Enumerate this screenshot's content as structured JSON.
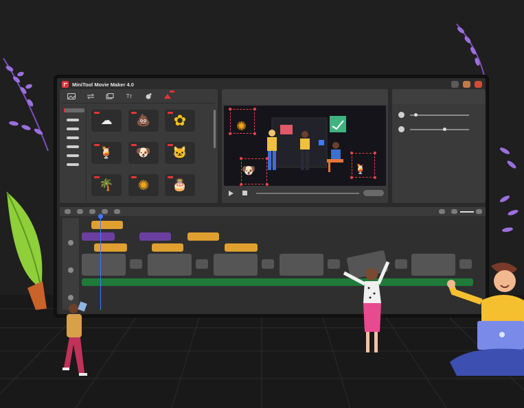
{
  "app": {
    "title": "MiniTool Movie Maker 4.0"
  },
  "colors": {
    "background": "#1f1f1f",
    "panel": "#3a3a3a",
    "accent_red": "#e33333",
    "clip_orange": "#e0a030",
    "clip_purple": "#6a3fa0",
    "clip_gray": "#555555",
    "audio_green": "#1f7a3a",
    "playhead_blue": "#3d7bff"
  },
  "media_toolbar": {
    "icons": [
      "media-icon",
      "transition-icon",
      "effects-icon",
      "text-icon",
      "filter-icon",
      "sticker-icon"
    ],
    "text_tab_label": "Tт"
  },
  "stickers": [
    {
      "name": "cloud",
      "glyph": "☁"
    },
    {
      "name": "poop",
      "glyph": "💩"
    },
    {
      "name": "flower",
      "glyph": "✿"
    },
    {
      "name": "drink",
      "glyph": "🍹"
    },
    {
      "name": "shiba",
      "glyph": "🐶"
    },
    {
      "name": "cat",
      "glyph": "🐱"
    },
    {
      "name": "palm",
      "glyph": "🌴"
    },
    {
      "name": "sun",
      "glyph": "✺"
    },
    {
      "name": "cake",
      "glyph": "🎂"
    }
  ],
  "preview": {
    "playback": {
      "progress": 0.0
    }
  },
  "timeline": {
    "tracks": [
      "overlay",
      "video",
      "audio"
    ]
  }
}
